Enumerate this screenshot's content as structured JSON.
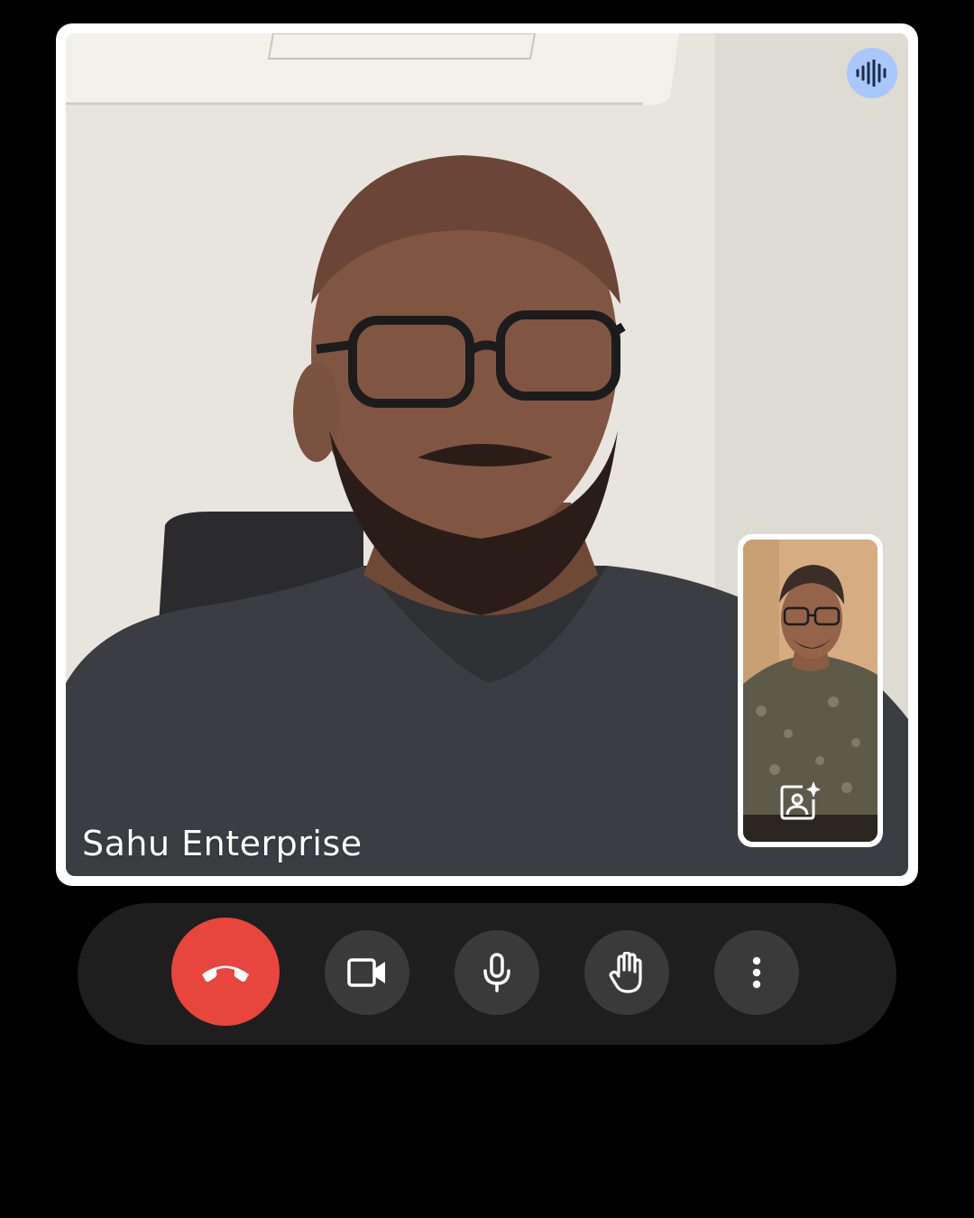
{
  "call": {
    "participant_name": "Sahu Enterprise"
  },
  "icons": {
    "speaking": "audio-waveform-icon",
    "effects": "visual-effects-icon",
    "end_call": "phone-hangup-icon",
    "camera": "videocam-icon",
    "mic": "mic-icon",
    "raise_hand": "hand-icon",
    "more": "more-vert-icon"
  },
  "colors": {
    "end_call": "#e8453c",
    "control_button": "#3a3a3a",
    "controls_bar": "#1e1e1e",
    "speaking_indicator": "#a8c7fa",
    "frame_border": "#ffffff"
  }
}
